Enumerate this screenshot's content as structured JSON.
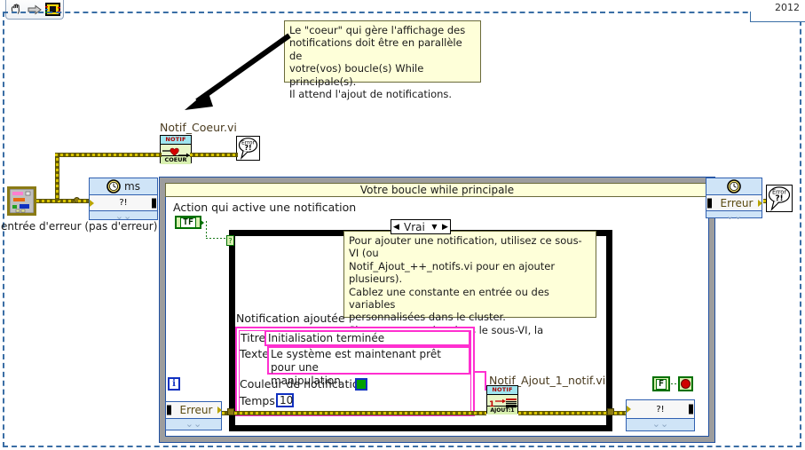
{
  "window": {
    "version_label": "2012",
    "toolbar": {
      "items": [
        {
          "name": "hand-tool-icon",
          "label": "hand"
        },
        {
          "name": "run-arrow-icon",
          "label": "run"
        },
        {
          "name": "vi-icon",
          "label": "vi"
        }
      ]
    }
  },
  "comments": {
    "coeur": "Le \"coeur\" qui gère l'affichage des\nnotifications doit être en parallèle de\nvotre(vos) boucle(s) While principale(s).\nIl attend l'ajout de notifications.",
    "ajout": "Pour ajouter une notification, utilisez ce sous-VI (ou\nNotif_Ajout_++_notifs.vi pour en ajouter plusieurs).\nCablez une constante en entrée ou des variables\npersonnalisées dans le cluster.\nSi une erreur arrive dans le sous-VI, la notification\nn'est pas ajoutée."
  },
  "coeur_vi": {
    "label": "Notif_Coeur.vi",
    "icon_header": "NOTIF",
    "icon_footer": "COEUR",
    "error_node_line1": "Error",
    "error_node_line2": "?!"
  },
  "error_input": {
    "caption": "entrée d'erreur (pas d'erreur)"
  },
  "wait_node": {
    "unit_label": "ms",
    "body_label": "?!",
    "icon": "clock-icon"
  },
  "while_loop": {
    "title": "Votre boucle while principale",
    "action_label": "Action qui active une notification",
    "bool_constant": "TF",
    "iteration_terminal": "i",
    "stop_constant": "F",
    "error_node_label": "Erreur",
    "error_out_node_label": "?!"
  },
  "case_structure": {
    "selector_value": "Vrai",
    "left_arrow": "◀",
    "right_arrow": "▶",
    "drop_arrow": "▼",
    "selector_terminal": "?"
  },
  "cluster": {
    "caption": "Notification ajoutée",
    "rows": [
      {
        "label": "Titre",
        "value": "Initialisation terminée"
      },
      {
        "label": "Texte",
        "value": "Le système est maintenant prêt pour une\nmanipulation"
      },
      {
        "label": "Couleur de notification",
        "value": ""
      },
      {
        "label": "Temps",
        "value": "10"
      }
    ],
    "color_value": "#00a000",
    "temps_value": "10"
  },
  "ajout_vi": {
    "label": "Notif_Ajout_1_notif.vi",
    "icon_header": "NOTIF",
    "icon_footer": "AJOUT:1",
    "icon_digit": "1"
  },
  "error_out": {
    "label": "Erreur",
    "error_node_line1": "Error",
    "error_node_line2": "?!",
    "icon": "clock-icon"
  },
  "colors": {
    "comment_bg": "#feffd9",
    "wire_error": "#8a7a14",
    "cluster_border": "#ff2fd0",
    "bool_green": "#007000",
    "blue_frame": "#3060b0",
    "stop_red": "#d00000"
  }
}
